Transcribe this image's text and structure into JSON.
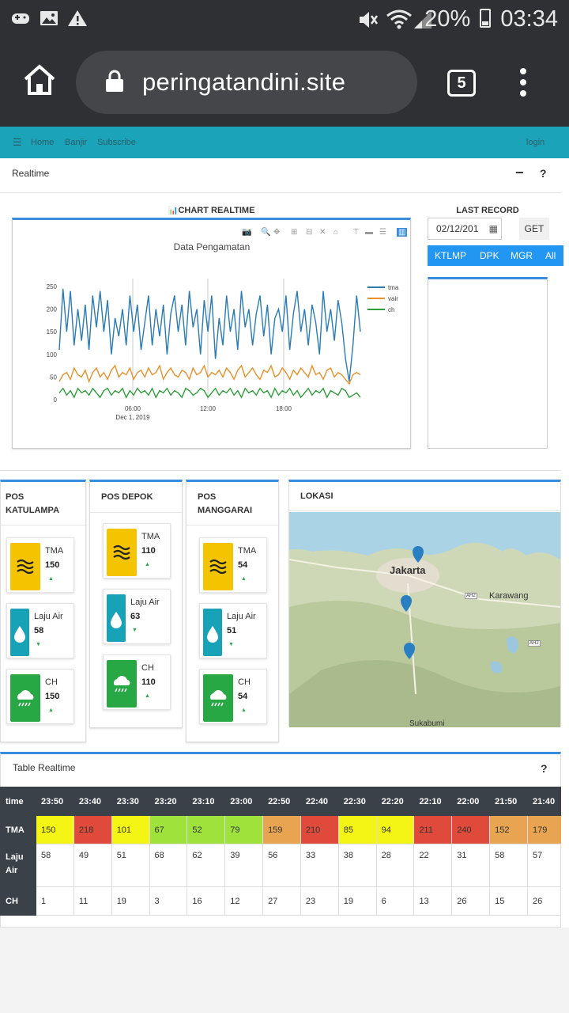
{
  "status": {
    "battery": "20%",
    "time": "03:34"
  },
  "browser": {
    "url": "peringatandini.site",
    "tab_count": "5"
  },
  "nav": {
    "home": "Home",
    "banjir": "Banjir",
    "subscribe": "Subscribe",
    "login": "login"
  },
  "realtime": {
    "title": "Realtime",
    "minus": "−",
    "help": "?"
  },
  "chart_header": "CHART REALTIME",
  "last_record": {
    "title": "LAST RECORD",
    "date": "02/12/201",
    "get": "GET",
    "buttons": [
      "KTLMP",
      "DPK",
      "MGR",
      "All"
    ]
  },
  "chart_data": {
    "type": "line",
    "title": "Data Pengamatan",
    "ylim": [
      0,
      250
    ],
    "yticks": [
      0,
      50,
      100,
      150,
      200,
      250
    ],
    "xtick_labels": [
      "06:00",
      "12:00",
      "18:00"
    ],
    "xdate": "Dec 1, 2019",
    "series": [
      {
        "name": "tma",
        "color": "#2b7bb4",
        "values": [
          110,
          245,
          150,
          240,
          120,
          200,
          130,
          210,
          110,
          230,
          160,
          240,
          150,
          220,
          100,
          180,
          140,
          200,
          120,
          230,
          150,
          210,
          110,
          170,
          230,
          120,
          200,
          140,
          210,
          100,
          190,
          230,
          150,
          210,
          120,
          240,
          160,
          200,
          100,
          220,
          150,
          230,
          90,
          180,
          120,
          230,
          150,
          200,
          110,
          240,
          160,
          200,
          120,
          190,
          230,
          140,
          210,
          100,
          180,
          200,
          150,
          230,
          110,
          190,
          240,
          150,
          200,
          120,
          210,
          170,
          100,
          240,
          150,
          200,
          130,
          220,
          170,
          90,
          40,
          120,
          230,
          150
        ]
      },
      {
        "name": "vair",
        "color": "#e8902a",
        "values": [
          40,
          55,
          60,
          45,
          70,
          55,
          50,
          65,
          40,
          60,
          70,
          50,
          60,
          45,
          65,
          75,
          50,
          60,
          55,
          70,
          45,
          60,
          65,
          50,
          70,
          55,
          60,
          75,
          45,
          60,
          70,
          55,
          50,
          65,
          60,
          45,
          70,
          55,
          60,
          75,
          50,
          60,
          55,
          65,
          50,
          70,
          60,
          45,
          65,
          75,
          50,
          60,
          70,
          55,
          45,
          65,
          60,
          75,
          50,
          55,
          70,
          60,
          45,
          65,
          55,
          70,
          60,
          50,
          75,
          55,
          60,
          45,
          65,
          70,
          50,
          60,
          55,
          45,
          35,
          55,
          60,
          55
        ]
      },
      {
        "name": "ch",
        "color": "#2e9e3a",
        "values": [
          15,
          25,
          10,
          20,
          5,
          25,
          15,
          20,
          10,
          25,
          15,
          5,
          20,
          25,
          10,
          20,
          15,
          25,
          5,
          20,
          10,
          25,
          15,
          20,
          10,
          25,
          5,
          20,
          15,
          25,
          10,
          20,
          15,
          5,
          25,
          20,
          10,
          15,
          25,
          20,
          5,
          15,
          25,
          10,
          20,
          15,
          25,
          10,
          20,
          5,
          25,
          15,
          20,
          10,
          25,
          15,
          20,
          5,
          25,
          10,
          20,
          15,
          25,
          10,
          20,
          5,
          15,
          25,
          10,
          20,
          15,
          25,
          5,
          20,
          15,
          10,
          25,
          20,
          5,
          10,
          15,
          5
        ]
      }
    ]
  },
  "pos": [
    {
      "title": "POS KATULAMPA",
      "tma": "150",
      "laju": "58",
      "ch": "150"
    },
    {
      "title": "POS DEPOK",
      "tma": "110",
      "laju": "63",
      "ch": "110"
    },
    {
      "title": "POS MANGGARAI",
      "tma": "54",
      "laju": "51",
      "ch": "54"
    }
  ],
  "labels": {
    "tma": "TMA",
    "laju": "Laju Air",
    "ch": "CH"
  },
  "lokasi": {
    "title": "LOKASI",
    "jakarta": "Jakarta",
    "karawang": "Karawang",
    "sukabumi": "Sukabumi",
    "ah2a": "AH2",
    "ah2b": "AH2"
  },
  "table": {
    "title": "Table Realtime",
    "help": "?",
    "time_label": "time",
    "times": [
      "23:50",
      "23:40",
      "23:30",
      "23:20",
      "23:10",
      "23:00",
      "22:50",
      "22:40",
      "22:30",
      "22:20",
      "22:10",
      "22:00",
      "21:50",
      "21:40"
    ],
    "tma_label": "TMA",
    "tma": [
      "150",
      "218",
      "101",
      "67",
      "52",
      "79",
      "159",
      "210",
      "85",
      "94",
      "211",
      "240",
      "152",
      "179"
    ],
    "tma_colors": [
      "#f4f415",
      "#e04a3b",
      "#f4f415",
      "#9fe23b",
      "#9fe23b",
      "#9fe23b",
      "#e8a450",
      "#e04a3b",
      "#f4f415",
      "#f4f415",
      "#e04a3b",
      "#e04a3b",
      "#e8a450",
      "#e8a450"
    ],
    "laju_label": "Laju Air",
    "laju": [
      "58",
      "49",
      "51",
      "68",
      "62",
      "39",
      "56",
      "33",
      "38",
      "28",
      "22",
      "31",
      "58",
      "57"
    ],
    "ch_label": "CH",
    "ch": [
      "1",
      "11",
      "19",
      "3",
      "16",
      "12",
      "27",
      "23",
      "19",
      "6",
      "13",
      "26",
      "15",
      "26"
    ]
  }
}
